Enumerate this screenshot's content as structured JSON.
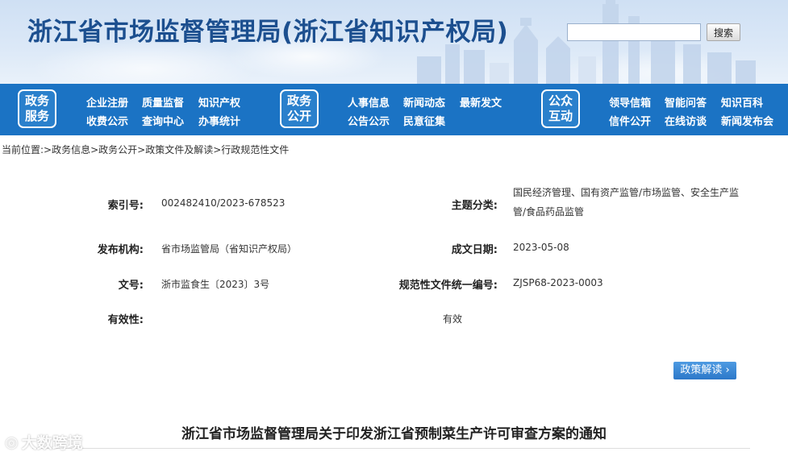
{
  "header": {
    "site_title": "浙江省市场监督管理局(浙江省知识产权局)",
    "search": {
      "placeholder": "",
      "button_label": "搜索"
    }
  },
  "nav": {
    "groups": [
      {
        "badge": [
          "政务",
          "服务"
        ],
        "links": [
          "企业注册",
          "质量监督",
          "知识产权",
          "收费公示",
          "查询中心",
          "办事统计"
        ]
      },
      {
        "badge": [
          "政务",
          "公开"
        ],
        "links": [
          "人事信息",
          "新闻动态",
          "最新发文",
          "公告公示",
          "民意征集"
        ]
      },
      {
        "badge": [
          "公众",
          "互动"
        ],
        "links": [
          "领导信箱",
          "智能问答",
          "知识百科",
          "信件公开",
          "在线访谈",
          "新闻发布会"
        ]
      }
    ]
  },
  "breadcrumb": {
    "prefix": "当前位置:",
    "items": [
      ">政务信息",
      ">政务公开",
      ">政策文件及解读",
      ">行政规范性文件"
    ]
  },
  "info": {
    "index_label": "索引号:",
    "index_value": "002482410/2023-678523",
    "topic_label": "主题分类:",
    "topic_value": "国民经济管理、国有资产监管/市场监管、安全生产监管/食品药品监管",
    "org_label": "发布机构:",
    "org_value": "省市场监管局（省知识产权局）",
    "date_label": "成文日期:",
    "date_value": "2023-05-08",
    "docno_label": "文号:",
    "docno_value": "浙市监食生〔2023〕3号",
    "normno_label": "规范性文件统一编号:",
    "normno_value": "ZJSP68-2023-0003",
    "validity_label": "有效性:",
    "validity_value": "有效"
  },
  "policy_button": "政策解读",
  "document_title": "浙江省市场监督管理局关于印发浙江省预制菜生产许可审查方案的通知",
  "watermark": "大数跨境",
  "colors": {
    "nav_bg": "#1b73c4",
    "title": "#1c4f8f"
  }
}
